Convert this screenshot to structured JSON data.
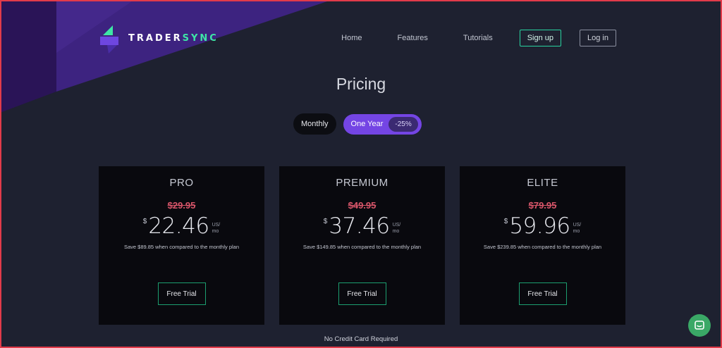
{
  "brand": {
    "name_part1": "TRADER",
    "name_part2": "SYNC",
    "accent_color": "#3ee6a6",
    "logo_icon": "tradersync-logo-icon"
  },
  "nav": {
    "links": [
      "Home",
      "Features",
      "Tutorials"
    ],
    "signup_label": "Sign up",
    "login_label": "Log in"
  },
  "page_title": "Pricing",
  "billing_toggle": {
    "monthly_label": "Monthly",
    "yearly_label": "One Year",
    "discount_badge": "-25%",
    "selected": "One Year",
    "selected_color": "#7445e4"
  },
  "plans": [
    {
      "name": "PRO",
      "old_price": "$29.95",
      "currency": "$",
      "price": "22.46",
      "per_line1": "US/",
      "per_line2": "mo",
      "save_text": "Save $89.85 when compared to the monthly plan",
      "cta": "Free Trial"
    },
    {
      "name": "PREMIUM",
      "old_price": "$49.95",
      "currency": "$",
      "price": "37.46",
      "per_line1": "US/",
      "per_line2": "mo",
      "save_text": "Save $149.85 when compared to the monthly plan",
      "cta": "Free Trial"
    },
    {
      "name": "ELITE",
      "old_price": "$79.95",
      "currency": "$",
      "price": "59.96",
      "per_line1": "US/",
      "per_line2": "mo",
      "save_text": "Save $239.85 when compared to the monthly plan",
      "cta": "Free Trial"
    }
  ],
  "footer_note": "No Credit Card Required",
  "chat_widget": {
    "icon": "chat-icon",
    "color": "#3aa866"
  },
  "colors": {
    "background": "#1e2130",
    "card_background": "#09090e",
    "strike_price": "#d9566a",
    "cta_border": "#1c9e6f"
  }
}
